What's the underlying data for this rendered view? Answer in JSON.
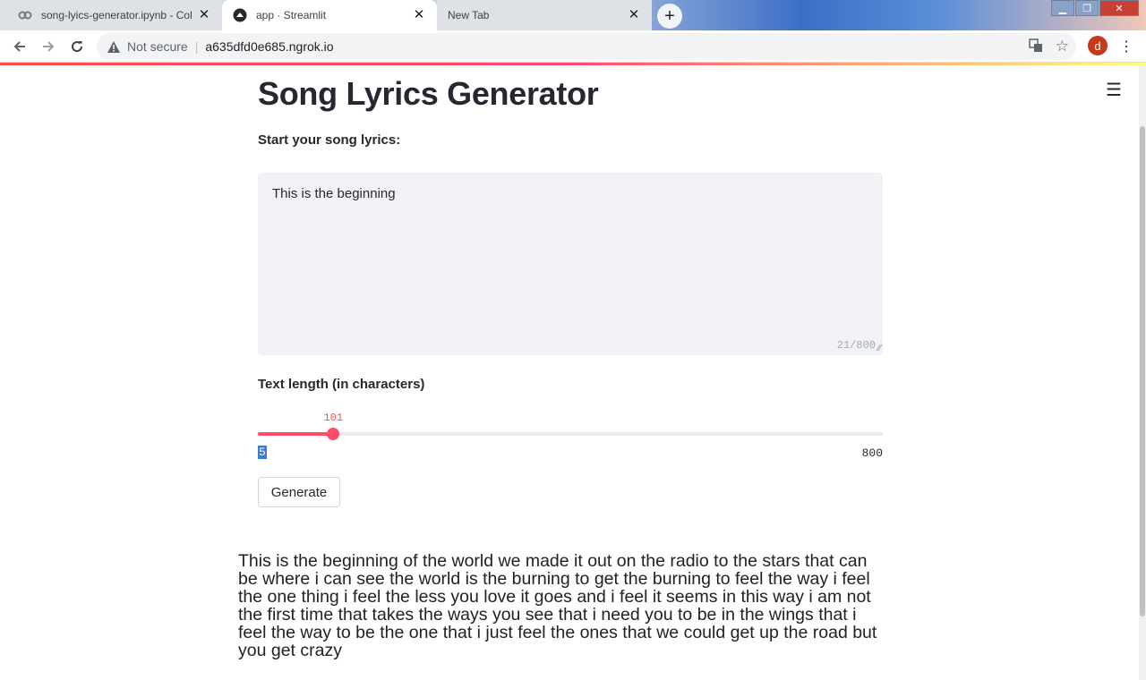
{
  "browser": {
    "tabs": [
      {
        "title": "song-lyics-generator.ipynb - Cola",
        "active": false
      },
      {
        "title": "app · Streamlit",
        "active": true
      },
      {
        "title": "New Tab",
        "active": false
      }
    ],
    "address": {
      "security_label": "Not secure",
      "url": "a635dfd0e685.ngrok.io"
    },
    "profile_initial": "d"
  },
  "app": {
    "title": "Song Lyrics Generator",
    "input_label": "Start your song lyrics:",
    "input_value": "This is the beginning",
    "char_count": "21/800",
    "slider_label": "Text length (in characters)",
    "slider_value": "101",
    "slider_min": "5",
    "slider_max": "800",
    "slider_fraction": 0.1208,
    "generate_label": "Generate",
    "output_text": "This is the beginning of the world we made it out on the radio to the stars that can be where i can see the world is the burning to get the burning to feel the way i feel the one thing i feel the less you love it goes and i feel it seems in this way i am not the first time that takes the ways you see that i need you to be in the wings that i feel the way to be the one that i just feel the ones that we could get up the road but you get crazy"
  },
  "colors": {
    "accent": "#ff4b6e",
    "text": "#262730",
    "input_bg": "#f0f2f6"
  }
}
